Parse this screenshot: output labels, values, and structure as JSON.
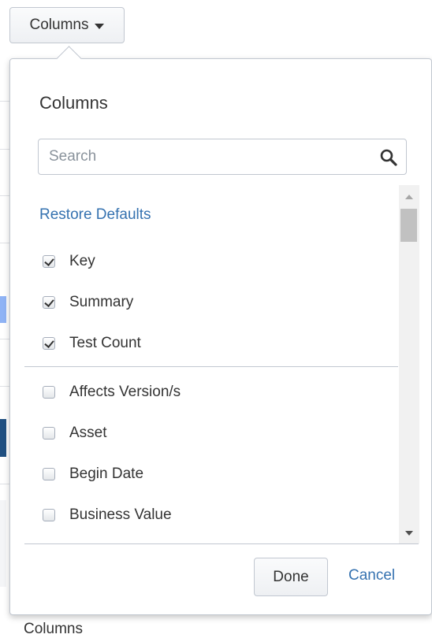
{
  "toolbar": {
    "columns_button_label": "Columns"
  },
  "popup": {
    "title": "Columns",
    "search": {
      "placeholder": "Search",
      "value": ""
    },
    "restore_defaults_label": "Restore Defaults",
    "selected_columns": [
      {
        "label": "Key",
        "checked": true
      },
      {
        "label": "Summary",
        "checked": true
      },
      {
        "label": "Test Count",
        "checked": true
      }
    ],
    "available_columns": [
      {
        "label": "Affects Version/s",
        "checked": false
      },
      {
        "label": "Asset",
        "checked": false
      },
      {
        "label": "Begin Date",
        "checked": false
      },
      {
        "label": "Business Value",
        "checked": false
      }
    ],
    "done_label": "Done",
    "cancel_label": "Cancel"
  },
  "background": {
    "footer_text": "Columns"
  },
  "colors": {
    "link": "#3572b0",
    "border": "#c1c7d0",
    "text": "#333333"
  }
}
